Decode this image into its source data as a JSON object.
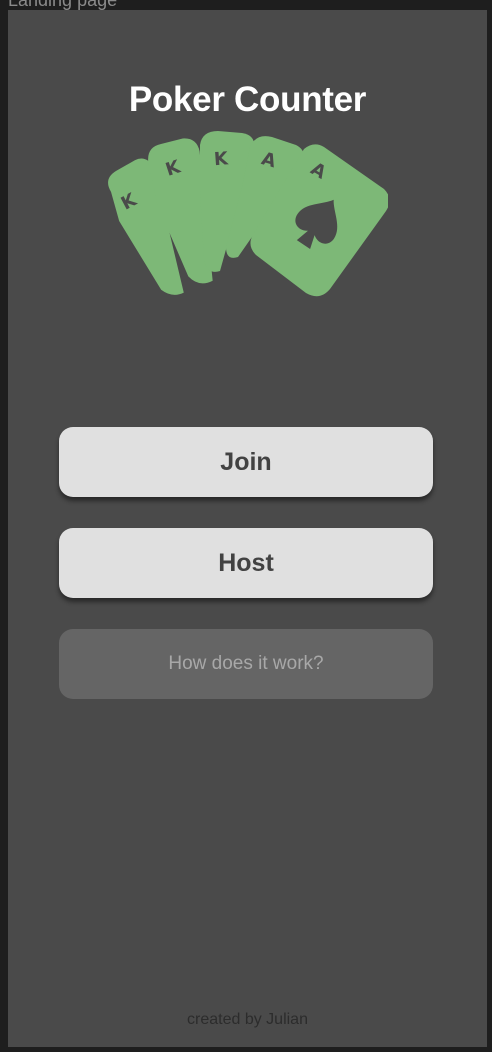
{
  "frame": {
    "label": "Landing page"
  },
  "app": {
    "title": "Poker Counter"
  },
  "logo": {
    "icon": "playing-cards-icon",
    "card_letters": [
      "K",
      "K",
      "K",
      "A",
      "A"
    ],
    "accent_color": "#7db877"
  },
  "buttons": {
    "join": "Join",
    "host": "Host",
    "how": "How does it work?"
  },
  "footer": {
    "credit": "created by Julian"
  },
  "colors": {
    "background": "#4a4a4a",
    "button_primary": "#e0e0e0",
    "button_secondary": "#656565",
    "text_dark": "#424242"
  }
}
